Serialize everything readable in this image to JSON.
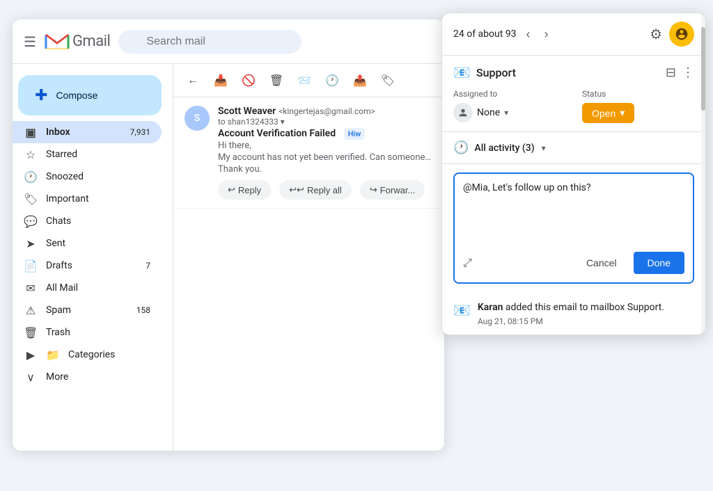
{
  "gmail": {
    "title": "Gmail",
    "search_placeholder": "Search mail",
    "compose_label": "Compose",
    "header": {
      "pagination": "24 of about 93"
    },
    "sidebar": {
      "items": [
        {
          "id": "inbox",
          "label": "Inbox",
          "count": "7,931",
          "icon": "☐"
        },
        {
          "id": "starred",
          "label": "Starred",
          "count": "",
          "icon": "★"
        },
        {
          "id": "snoozed",
          "label": "Snoozed",
          "count": "",
          "icon": "🕐"
        },
        {
          "id": "important",
          "label": "Important",
          "count": "",
          "icon": "🏷"
        },
        {
          "id": "chats",
          "label": "Chats",
          "count": "",
          "icon": "💬"
        },
        {
          "id": "sent",
          "label": "Sent",
          "count": "",
          "icon": "➤"
        },
        {
          "id": "drafts",
          "label": "Drafts",
          "count": "7",
          "icon": "📄"
        },
        {
          "id": "allmail",
          "label": "All Mail",
          "count": "",
          "icon": "✉"
        },
        {
          "id": "spam",
          "label": "Spam",
          "count": "158",
          "icon": "⚠"
        },
        {
          "id": "trash",
          "label": "Trash",
          "count": "",
          "icon": "🗑"
        },
        {
          "id": "categories",
          "label": "Categories",
          "count": "",
          "icon": "📁"
        },
        {
          "id": "more",
          "label": "More",
          "count": "",
          "icon": "∨"
        }
      ]
    },
    "email": {
      "from": "Scott Weaver",
      "from_email": "<kingertejas@gmail.com>",
      "to": "to shan1324333 ▾",
      "subject": "Account Verification Failed",
      "hiw_label": "Hiw",
      "body_preview": "Hi there,",
      "body_line2": "My account has not yet been verified. Can someone plea...",
      "body_line3": "Thank you.",
      "actions": {
        "reply": "Reply",
        "reply_all": "Reply all",
        "forward": "Forwar..."
      }
    }
  },
  "support_panel": {
    "pagination": "24 of about 93",
    "gear_icon": "⚙",
    "columns_icon": "⊟",
    "more_icon": "⋮",
    "support_label": "Support",
    "support_icon": "📧",
    "assigned_label": "Assigned to",
    "assigned_value": "None",
    "status_label": "Status",
    "status_value": "Open",
    "status_color": "#f29900",
    "activity_label": "All activity (3)",
    "activity_count": 3,
    "reply_text": "@Mia, Let's follow up on this?",
    "cancel_label": "Cancel",
    "done_label": "Done",
    "log": {
      "icon": "📧",
      "text_bold": "Karan",
      "text_rest": " added this email to mailbox Support.",
      "time": "Aug 21, 08:15 PM"
    }
  }
}
